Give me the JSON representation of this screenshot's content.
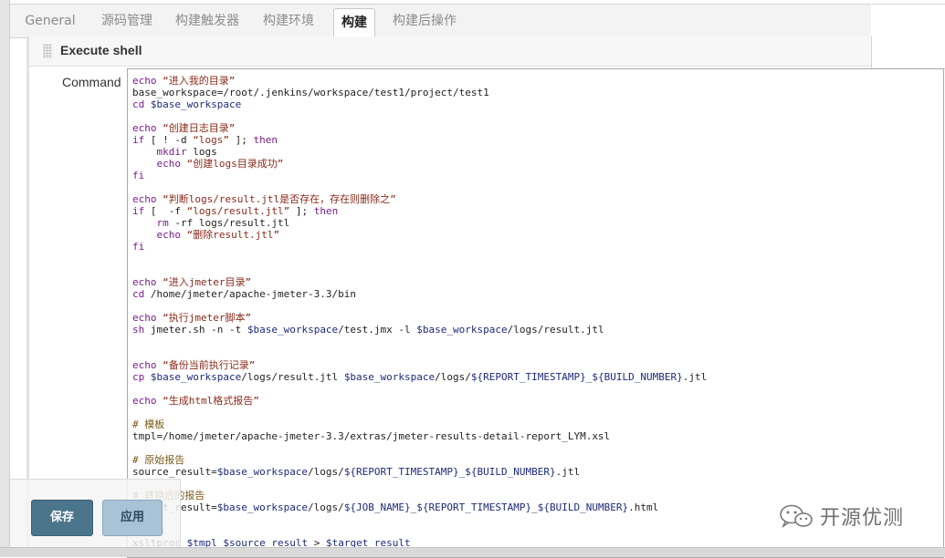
{
  "tabs": [
    {
      "label": "General",
      "active": false
    },
    {
      "label": "源码管理",
      "active": false
    },
    {
      "label": "构建触发器",
      "active": false
    },
    {
      "label": "构建环境",
      "active": false
    },
    {
      "label": "构建",
      "active": true
    },
    {
      "label": "构建后操作",
      "active": false
    }
  ],
  "section": {
    "title": "Execute shell"
  },
  "command": {
    "label": "Command",
    "lines": [
      "echo “进入我的目录”",
      "base_workspace=/root/.jenkins/workspace/test1/project/test1",
      "cd $base_workspace",
      "",
      "echo “创建日志目录”",
      "if [ ! -d “logs” ]; then",
      "    mkdir logs",
      "    echo “创建logs目录成功”",
      "fi",
      "",
      "echo “判断logs/result.jtl是否存在，存在则删除之”",
      "if [  -f “logs/result.jtl” ]; then",
      "    rm -rf logs/result.jtl",
      "    echo “删除result.jtl”",
      "fi",
      "",
      "",
      "echo “进入jmeter目录”",
      "cd /home/jmeter/apache-jmeter-3.3/bin",
      "",
      "echo “执行jmeter脚本”",
      "sh jmeter.sh -n -t $base_workspace/test.jmx -l $base_workspace/logs/result.jtl",
      "",
      "",
      "echo “备份当前执行记录”",
      "cp $base_workspace/logs/result.jtl $base_workspace/logs/${REPORT_TIMESTAMP}_${BUILD_NUMBER}.jtl",
      "",
      "echo “生成html格式报告”",
      "",
      "# 模板",
      "tmpl=/home/jmeter/apache-jmeter-3.3/extras/jmeter-results-detail-report_LYM.xsl",
      "",
      "# 原始报告",
      "source_result=$base_workspace/logs/${REPORT_TIMESTAMP}_${BUILD_NUMBER}.jtl",
      "",
      "# 转换后的报告",
      "target_result=$base_workspace/logs/${JOB_NAME}_${REPORT_TIMESTAMP}_${BUILD_NUMBER}.html",
      "",
      "# 转换",
      "xsltproc $tmpl $source_result > $target_result"
    ]
  },
  "buttons": {
    "save": "保存",
    "apply": "应用"
  },
  "watermark": {
    "text": "开源优测"
  }
}
